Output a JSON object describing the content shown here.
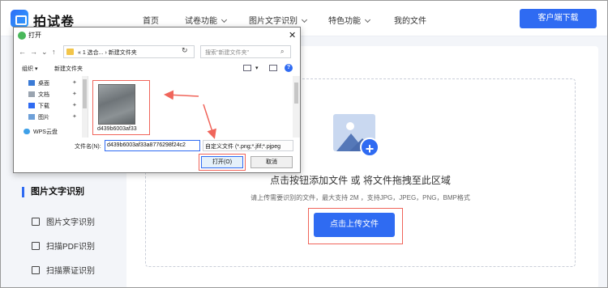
{
  "site": {
    "logo_text": "拍试卷",
    "nav": [
      "首页",
      "试卷功能",
      "图片文字识别",
      "特色功能",
      "我的文件"
    ],
    "download_label": "客户端下载"
  },
  "upload": {
    "title": "点击按钮添加文件 或 将文件拖拽至此区域",
    "subtitle": "请上传需要识别的文件，最大支持 2M ，支持JPG，JPEG，PNG，BMP格式",
    "button_label": "点击上传文件"
  },
  "sidebar": {
    "heading": "图片文字识别",
    "items": [
      "图片文字识别",
      "扫描PDF识别",
      "扫描票证识别"
    ]
  },
  "dialog": {
    "title": "打开",
    "close": "✕",
    "nav_back": "←",
    "nav_forward": "→",
    "nav_down": "⌄",
    "nav_up": "↑",
    "breadcrumb": "«  1 选合...  ›  新建文件夹",
    "search_placeholder": "搜索\"新建文件夹\"",
    "organize": "组织 ▾",
    "new_folder": "新建文件夹",
    "nav_entries": [
      "桌面",
      "文档",
      "下载",
      "图片",
      "WPS云盘"
    ],
    "file_name_display": "d439b6003af33",
    "file_name_label": "文件名(N):",
    "file_name_value": "d439b6003af33a8776298f24c2",
    "file_type_value": "自定义文件 (*.png;*.jfif;*.pjpeg",
    "open_label": "打开(O)",
    "cancel_label": "取消"
  },
  "colors": {
    "accent": "#2f6bf2",
    "highlight": "#f0655b"
  }
}
